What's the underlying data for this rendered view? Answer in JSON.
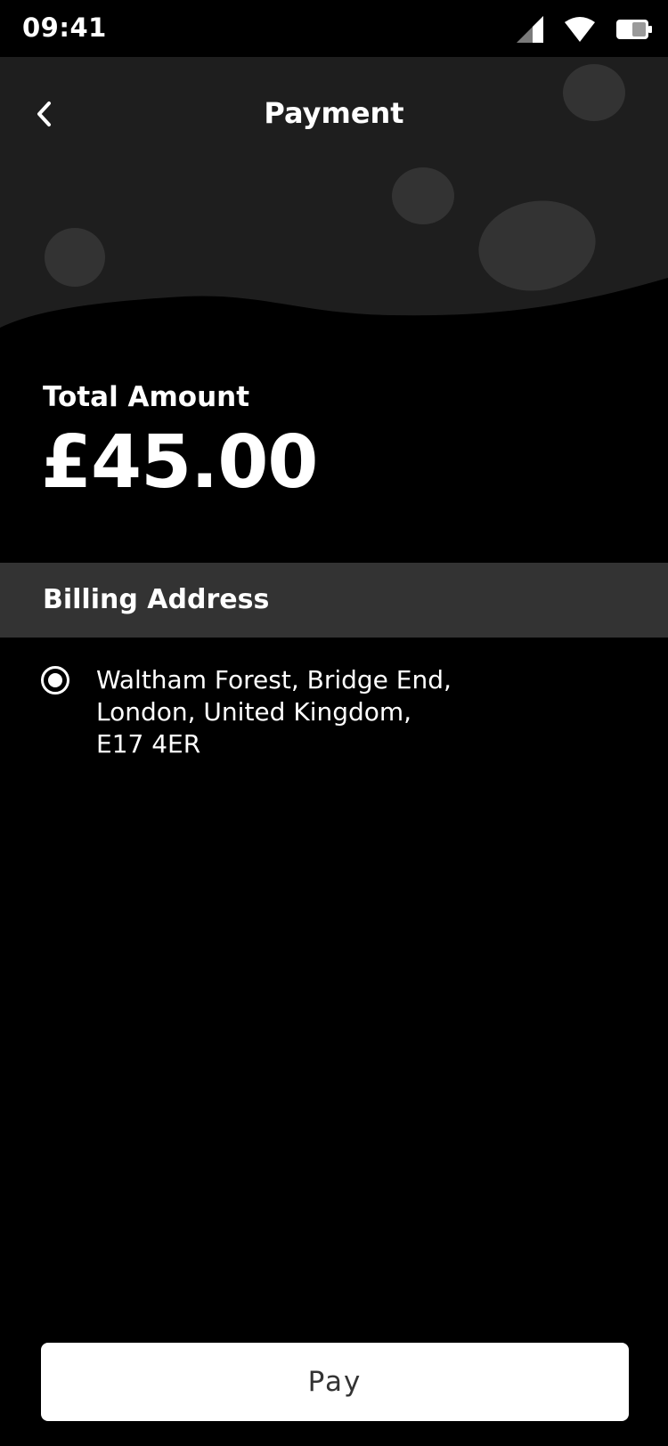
{
  "status_bar": {
    "time": "09:41",
    "icons": [
      "signal-icon",
      "wifi-icon",
      "battery-icon"
    ]
  },
  "header": {
    "title": "Payment",
    "back_icon": "chevron-left-icon"
  },
  "total": {
    "label": "Total Amount",
    "amount": "£45.00"
  },
  "billing": {
    "section_title": "Billing Address",
    "address": {
      "selected": true,
      "lines": [
        "Waltham Forest, Bridge End,",
        "London, United Kingdom,",
        "E17 4ER"
      ]
    }
  },
  "actions": {
    "pay_label": "Pay"
  },
  "colors": {
    "background": "#000000",
    "header": "#1e1e1e",
    "header_blob": "#333333",
    "section_bar": "#333333",
    "button_bg": "#ffffff",
    "button_text": "#333333"
  }
}
